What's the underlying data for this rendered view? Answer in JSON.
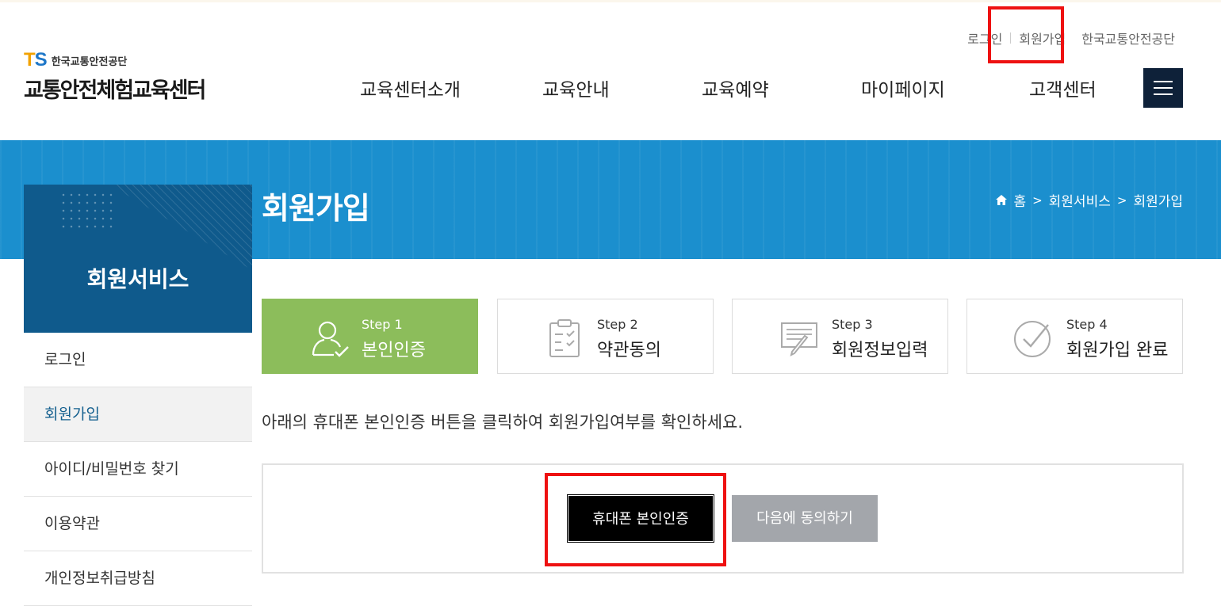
{
  "util_nav": [
    "로그인",
    "회원가입",
    "한국교통안전공단"
  ],
  "logo": {
    "brand": "TS",
    "org": "한국교통안전공단",
    "center": "교통안전체험교육센터"
  },
  "gnb": [
    "교육센터소개",
    "교육안내",
    "교육예약",
    "마이페이지",
    "고객센터"
  ],
  "menu_icon": "hamburger-icon",
  "page_title": "회원가입",
  "breadcrumb": {
    "icon": "home-icon",
    "items": [
      "홈",
      "회원서비스",
      "회원가입"
    ]
  },
  "side": {
    "title": "회원서비스",
    "items": [
      "로그인",
      "회원가입",
      "아이디/비밀번호 찾기",
      "이용약관",
      "개인정보취급방침"
    ],
    "active_index": 1
  },
  "steps": [
    {
      "num": "Step 1",
      "label": "본인인증",
      "icon": "person-check-icon",
      "active": true
    },
    {
      "num": "Step 2",
      "label": "약관동의",
      "icon": "clipboard-check-icon",
      "active": false
    },
    {
      "num": "Step 3",
      "label": "회원정보입력",
      "icon": "form-pen-icon",
      "active": false
    },
    {
      "num": "Step 4",
      "label": "회원가입 완료",
      "icon": "check-circle-icon",
      "active": false
    }
  ],
  "guide_text": "아래의 휴대폰 본인인증 버튼을 클릭하여 회원가입여부를 확인하세요.",
  "buttons": {
    "phone_auth": "휴대폰 본인인증",
    "next": "다음에 동의하기"
  },
  "colors": {
    "banner": "#1b8fce",
    "sidebox": "#0f5a8c",
    "step_active": "#8cbd5b",
    "highlight": "#ee1111"
  }
}
